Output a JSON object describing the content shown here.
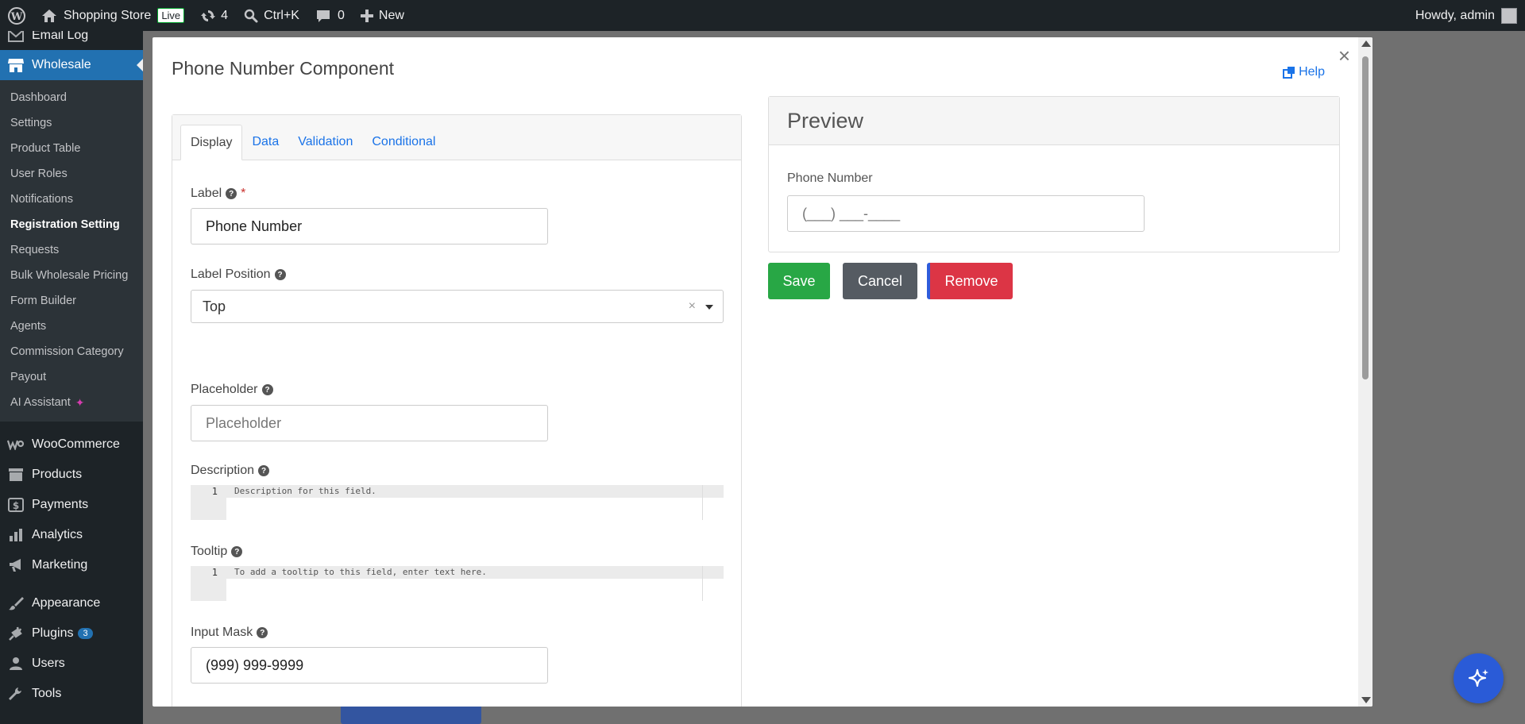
{
  "adminbar": {
    "site_name": "Shopping Store",
    "live_badge": "Live",
    "updates_count": "4",
    "search_shortcut": "Ctrl+K",
    "comments_count": "0",
    "new_label": "New",
    "greeting": "Howdy, admin"
  },
  "sidebar": {
    "email_log": "Email Log",
    "wholesale": "Wholesale",
    "submenu": [
      "Dashboard",
      "Settings",
      "Product Table",
      "User Roles",
      "Notifications",
      "Registration Setting",
      "Requests",
      "Bulk Wholesale Pricing",
      "Form Builder",
      "Agents",
      "Commission Category",
      "Payout",
      "AI Assistant"
    ],
    "woocommerce": "WooCommerce",
    "products": "Products",
    "payments": "Payments",
    "analytics": "Analytics",
    "marketing": "Marketing",
    "appearance": "Appearance",
    "plugins": "Plugins",
    "plugins_badge": "3",
    "users": "Users",
    "tools": "Tools"
  },
  "modal": {
    "title": "Phone Number Component",
    "help": "Help",
    "close": "×",
    "tabs": [
      "Display",
      "Data",
      "Validation",
      "Conditional"
    ],
    "fields": {
      "label_label": "Label",
      "label_value": "Phone Number",
      "label_position_label": "Label Position",
      "label_position_value": "Top",
      "placeholder_label": "Placeholder",
      "placeholder_placeholder": "Placeholder",
      "description_label": "Description",
      "description_line_no": "1",
      "description_placeholder": "Description for this field.",
      "tooltip_label": "Tooltip",
      "tooltip_line_no": "1",
      "tooltip_placeholder": "To add a tooltip to this field, enter text here.",
      "input_mask_label": "Input Mask",
      "input_mask_value": "(999) 999-9999"
    },
    "preview": {
      "title": "Preview",
      "field_label": "Phone Number",
      "field_mask": "(___) ___-____"
    },
    "buttons": {
      "save": "Save",
      "cancel": "Cancel",
      "remove": "Remove"
    }
  },
  "colors": {
    "admin_dark": "#1d2327",
    "wp_blue": "#2271b1",
    "save_green": "#28a745",
    "cancel_gray": "#555b62",
    "remove_red": "#dc3545",
    "link_blue": "#1a73e8"
  }
}
